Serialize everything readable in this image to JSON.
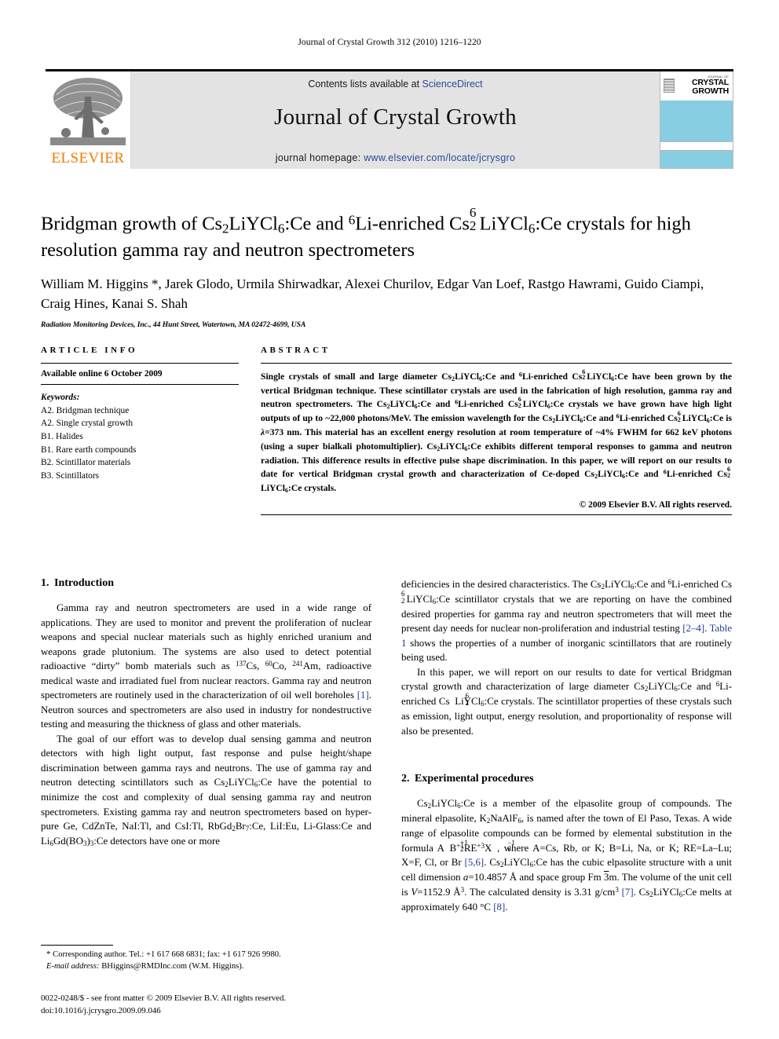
{
  "running_head": "Journal of Crystal Growth 312 (2010) 1216–1220",
  "masthead": {
    "elsevier_wordmark": "ELSEVIER",
    "contents_prefix": "Contents lists available at ",
    "contents_link": "ScienceDirect",
    "journal_name": "Journal of Crystal Growth",
    "homepage_prefix": "journal homepage: ",
    "homepage_link": "www.elsevier.com/locate/jcrysgro",
    "cover": {
      "kicker": "JOURNAL OF",
      "line1": "CRYSTAL",
      "line2": "GROWTH",
      "band_color": "#87cee3"
    }
  },
  "article": {
    "title_line1_a": "Bridgman growth of Cs",
    "title_line1_b": "LiYCl",
    "title_line1_c": ":Ce and ",
    "title_line1_d": "Li-enriched Cs",
    "title_line1_e": "LiYCl",
    "title_line1_f": ":Ce crystals for",
    "title_line2": "high resolution gamma ray and neutron spectrometers",
    "title_plain": "Bridgman growth of Cs2LiYCl6:Ce and 6Li-enriched Cs2 6LiYCl6:Ce crystals for high resolution gamma ray and neutron spectrometers",
    "authors_line1": "William M. Higgins *, Jarek Glodo, Urmila Shirwadkar, Alexei Churilov, Edgar Van Loef, Rastgo Hawrami,",
    "authors_line2": "Guido Ciampi, Craig Hines, Kanai S. Shah",
    "affiliation": "Radiation Monitoring Devices, Inc., 44 Hunt Street, Watertown, MA 02472-4699, USA"
  },
  "article_info": {
    "heading": "ARTICLE INFO",
    "history": "Available online 6 October 2009",
    "keywords_label": "Keywords:",
    "keywords": [
      "A2. Bridgman technique",
      "A2. Single crystal growth",
      "B1. Halides",
      "B1. Rare earth compounds",
      "B2. Scintillator materials",
      "B3. Scintillators"
    ]
  },
  "abstract": {
    "heading": "ABSTRACT",
    "copyright": "© 2009 Elsevier B.V. All rights reserved.",
    "text_plain": "Single crystals of small and large diameter Cs2LiYCl6:Ce and 6Li-enriched Cs2 6LiYCl6:Ce have been grown by the vertical Bridgman technique. These scintillator crystals are used in the fabrication of high resolution, gamma ray and neutron spectrometers. The Cs2LiYCl6:Ce and 6Li-enriched Cs2 6LiYCl6:Ce crystals we have grown have high light outputs of up to ~22,000 photons/MeV. The emission wavelength for the Cs2LiYCl6:Ce and 6Li-enriched Cs2 6LiYCl6:Ce is λ=373 nm. This material has an excellent energy resolution at room temperature of ~4% FWHM for 662 keV photons (using a super bialkali photomultiplier). Cs2LiYCl6:Ce exhibits different temporal responses to gamma and neutron radiation. This difference results in effective pulse shape discrimination. In this paper, we will report on our results to date for vertical Bridgman crystal growth and characterization of Ce-doped Cs2LiYCl6:Ce and 6Li-enriched Cs2 6LiYCl6:Ce crystals."
  },
  "sections": {
    "intro": {
      "number": "1.",
      "title": "Introduction",
      "p1_plain": "Gamma ray and neutron spectrometers are used in a wide range of applications. They are used to monitor and prevent the proliferation of nuclear weapons and special nuclear materials such as highly enriched uranium and weapons grade plutonium. The systems are also used to detect potential radioactive “dirty” bomb materials such as 137Cs, 60Co, 241Am, radioactive medical waste and irradiated fuel from nuclear reactors. Gamma ray and neutron spectrometers are routinely used in the characterization of oil well boreholes [1]. Neutron sources and spectrometers are also used in industry for nondestructive testing and measuring the thickness of glass and other materials.",
      "p2_plain": "The goal of our effort was to develop dual sensing gamma and neutron detectors with high light output, fast response and pulse height/shape discrimination between gamma rays and neutrons. The use of gamma ray and neutron detecting scintillators such as Cs2LiYCl6:Ce have the potential to minimize the cost and complexity of dual sensing gamma ray and neutron spectrometers. Existing gamma ray and neutron spectrometers based on hyper-pure Ge, CdZnTe, NaI:Tl, and CsI:Tl, RbGd2Br7:Ce, LiI:Eu, Li-Glass:Ce and Li6Gd(BO3)3:Ce detectors have one or more deficiencies in the desired characteristics. The Cs2LiYCl6:Ce and 6Li-enriched Cs2 6LiYCl6:Ce scintillator crystals that we are reporting on have the combined desired properties for gamma ray and neutron spectrometers that will meet the present day needs for nuclear non-proliferation and industrial testing [2–4]. Table 1 shows the properties of a number of inorganic scintillators that are routinely being used.",
      "p3_plain": "In this paper, we will report on our results to date for vertical Bridgman crystal growth and characterization of large diameter Cs2LiYCl6:Ce and 6Li-enriched Cs2 6LiYCl6:Ce crystals. The scintillator properties of these crystals such as emission, light output, energy resolution, and proportionality of response will also be presented."
    },
    "experimental": {
      "number": "2.",
      "title": "Experimental procedures",
      "p1_plain": "Cs2LiYCl6:Ce is a member of the elpasolite group of compounds. The mineral elpasolite, K2NaAlF6, is named after the town of El Paso, Texas. A wide range of elpasolite compounds can be formed by elemental substitution in the formula A2+1B+1RE+3X6−1, where A=Cs, Rb, or K; B=Li, Na, or K; RE=La–Lu; X=F, Cl, or Br [5,6]. Cs2LiYCl6:Ce has the cubic elpasolite structure with a unit cell dimension a=10.4857 Å and space group Fm 3̄m. The volume of the unit cell is V=1152.9 Å3. The calculated density is 3.31 g/cm3 [7]. Cs2LiYCl6:Ce melts at approximately 640 °C [8]."
    }
  },
  "footnote": {
    "star": "*",
    "corresponding": " Corresponding author. Tel.: +1 617 668 6831; fax: +1 617 926 9980.",
    "email_label": "E-mail address:",
    "email": " BHiggins@RMDInc.com (W.M. Higgins)."
  },
  "footer": {
    "line1": "0022-0248/$ - see front matter © 2009 Elsevier B.V. All rights reserved.",
    "line2": "doi:10.1016/j.jcrysgro.2009.09.046"
  },
  "colors": {
    "link_blue": "#2b4a9b",
    "ref_blue": "#1b3f94",
    "elsevier_orange": "#ef7d00",
    "band_gray": "#e3e3e3",
    "cover_blue": "#87cee3"
  }
}
